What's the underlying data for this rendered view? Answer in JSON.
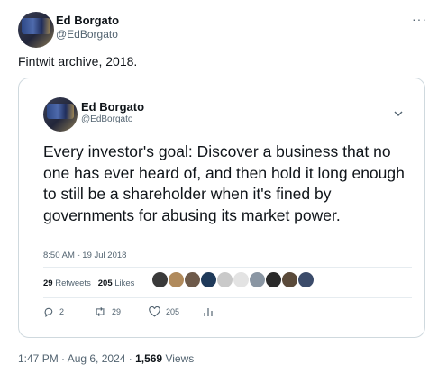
{
  "author": {
    "name": "Ed Borgato",
    "handle": "@EdBorgato"
  },
  "tweet": {
    "text": "Fintwit archive, 2018."
  },
  "more_icon": "more-horizontal-icon",
  "quoted": {
    "name": "Ed Borgato",
    "handle": "@EdBorgato",
    "text": "Every investor's goal: Discover a business that no one has ever heard of, and then hold it long enough to still be a shareholder when it's fined by governments for abusing its market power.",
    "timestamp": "8:50 AM - 19 Jul 2018",
    "retweets_count": "29",
    "retweets_label": "Retweets",
    "likes_count": "205",
    "likes_label": "Likes",
    "likers": [
      "#3a3a3a",
      "#b08a5c",
      "#6e5a4a",
      "#1f3a5a",
      "#c9c9c9",
      "#e3e3e3",
      "#8a96a3",
      "#2a2a2a",
      "#5a4a3a",
      "#3b4b6a"
    ],
    "actions": {
      "replies": "2",
      "retweets": "29",
      "likes": "205"
    }
  },
  "footer": {
    "time": "1:47 PM · Aug 6, 2024 · ",
    "views_count": "1,569",
    "views_label": " Views"
  },
  "colors": {
    "secondary_text": "#536471",
    "border": "#cfd9de",
    "text": "#0f1419"
  }
}
